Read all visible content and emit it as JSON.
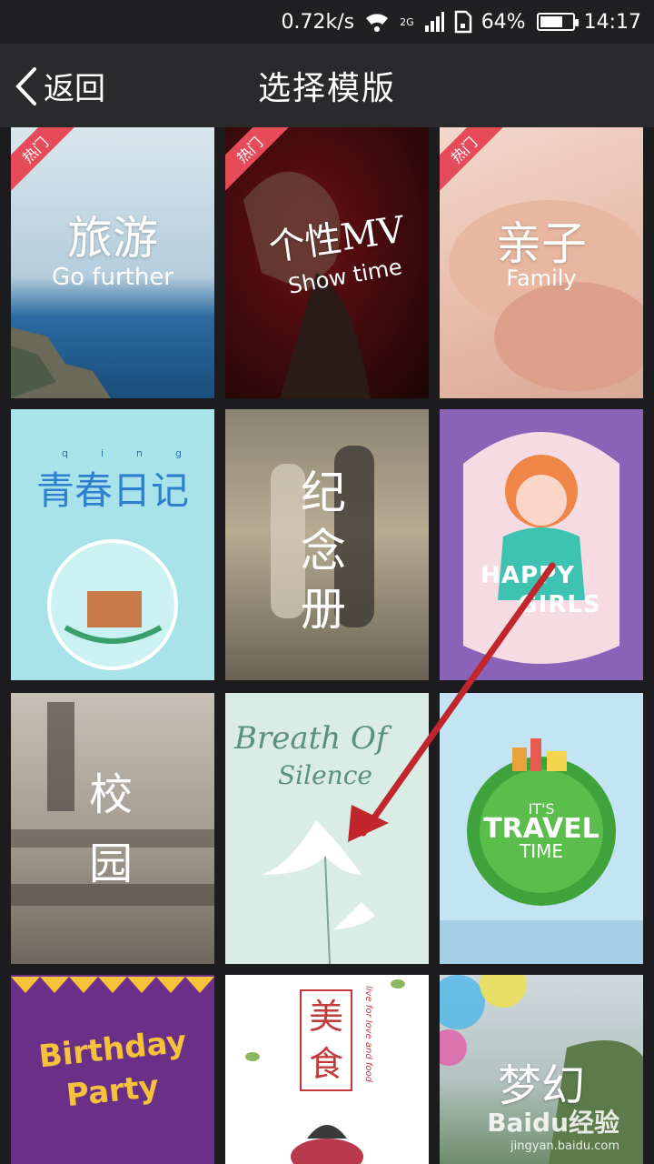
{
  "status": {
    "speed": "0.72k/s",
    "net": "2G",
    "battery": "64%",
    "time": "14:17"
  },
  "header": {
    "back_label": "返回",
    "title": "选择模版"
  },
  "badge_label": "热门",
  "tiles": {
    "travel": {
      "cn": "旅游",
      "en": "Go further"
    },
    "mv": {
      "cn": "个性MV",
      "en": "Show time"
    },
    "family": {
      "cn": "亲子",
      "en": "Family"
    },
    "youth": {
      "cn": "青春日记",
      "pinyin1": "qing",
      "pinyin2": "chun"
    },
    "memorial": {
      "cn": "纪念册"
    },
    "happy": {
      "line1": "HAPPY",
      "line2": "GIRLS"
    },
    "campus": {
      "cn": "校园"
    },
    "breath": {
      "line1": "Breath Of",
      "line2": "Silence"
    },
    "travel_time": {
      "l1": "IT'S",
      "l2": "TRAVEL",
      "l3": "TIME"
    },
    "birthday": {
      "line1": "Birthday",
      "line2": "Party"
    },
    "food": {
      "cn": "美食",
      "side": "live for love and food"
    },
    "dream": {
      "cn": "梦幻"
    }
  },
  "watermark": {
    "brand": "Baidu经验",
    "url": "jingyan.baidu.com"
  }
}
